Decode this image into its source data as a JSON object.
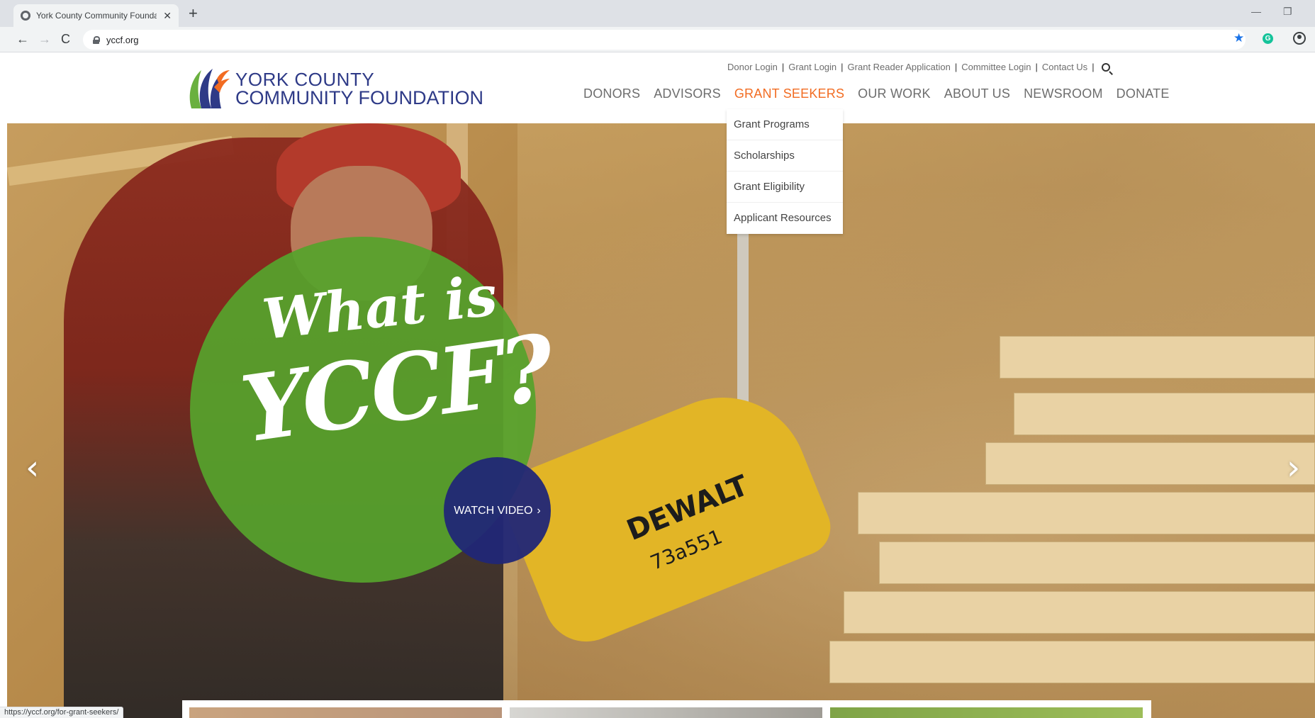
{
  "browser": {
    "tab_title": "York County Community Founda",
    "tab_close": "✕",
    "new_tab": "+",
    "window_min": "—",
    "window_max": "❐",
    "back": "←",
    "forward": "→",
    "reload": "C",
    "url": "yccf.org",
    "star": "★",
    "extension": "G",
    "status_url": "https://yccf.org/for-grant-seekers/"
  },
  "site": {
    "logo": {
      "line1": "YORK COUNTY",
      "line2": "COMMUNITY FOUNDATION",
      "colors": {
        "text": "#2e3a87",
        "orange": "#f26c22",
        "green": "#6ab03f",
        "navy": "#2e3a87"
      }
    },
    "utility_links": [
      "Donor Login",
      "Grant Login",
      "Grant Reader Application",
      "Committee Login",
      "Contact Us"
    ],
    "utility_separator": "|",
    "main_nav": [
      {
        "label": "DONORS",
        "active": false
      },
      {
        "label": "ADVISORS",
        "active": false
      },
      {
        "label": "GRANT SEEKERS",
        "active": true
      },
      {
        "label": "OUR WORK",
        "active": false
      },
      {
        "label": "ABOUT US",
        "active": false
      },
      {
        "label": "NEWSROOM",
        "active": false
      },
      {
        "label": "DONATE",
        "active": false
      }
    ],
    "dropdown": [
      "Grant Programs",
      "Scholarships",
      "Grant Eligibility",
      "Applicant Resources"
    ],
    "accent_color": "#f26c22"
  },
  "hero": {
    "headline_line1": "What is",
    "headline_line2": "YCCF?",
    "cta": "WATCH VIDEO",
    "cta_chevron": "›",
    "saw_brand": "DEWALT",
    "saw_model": "73a551",
    "prev": "‹",
    "next": "›",
    "circle_color": "#56a32c",
    "cta_color": "#212776"
  }
}
